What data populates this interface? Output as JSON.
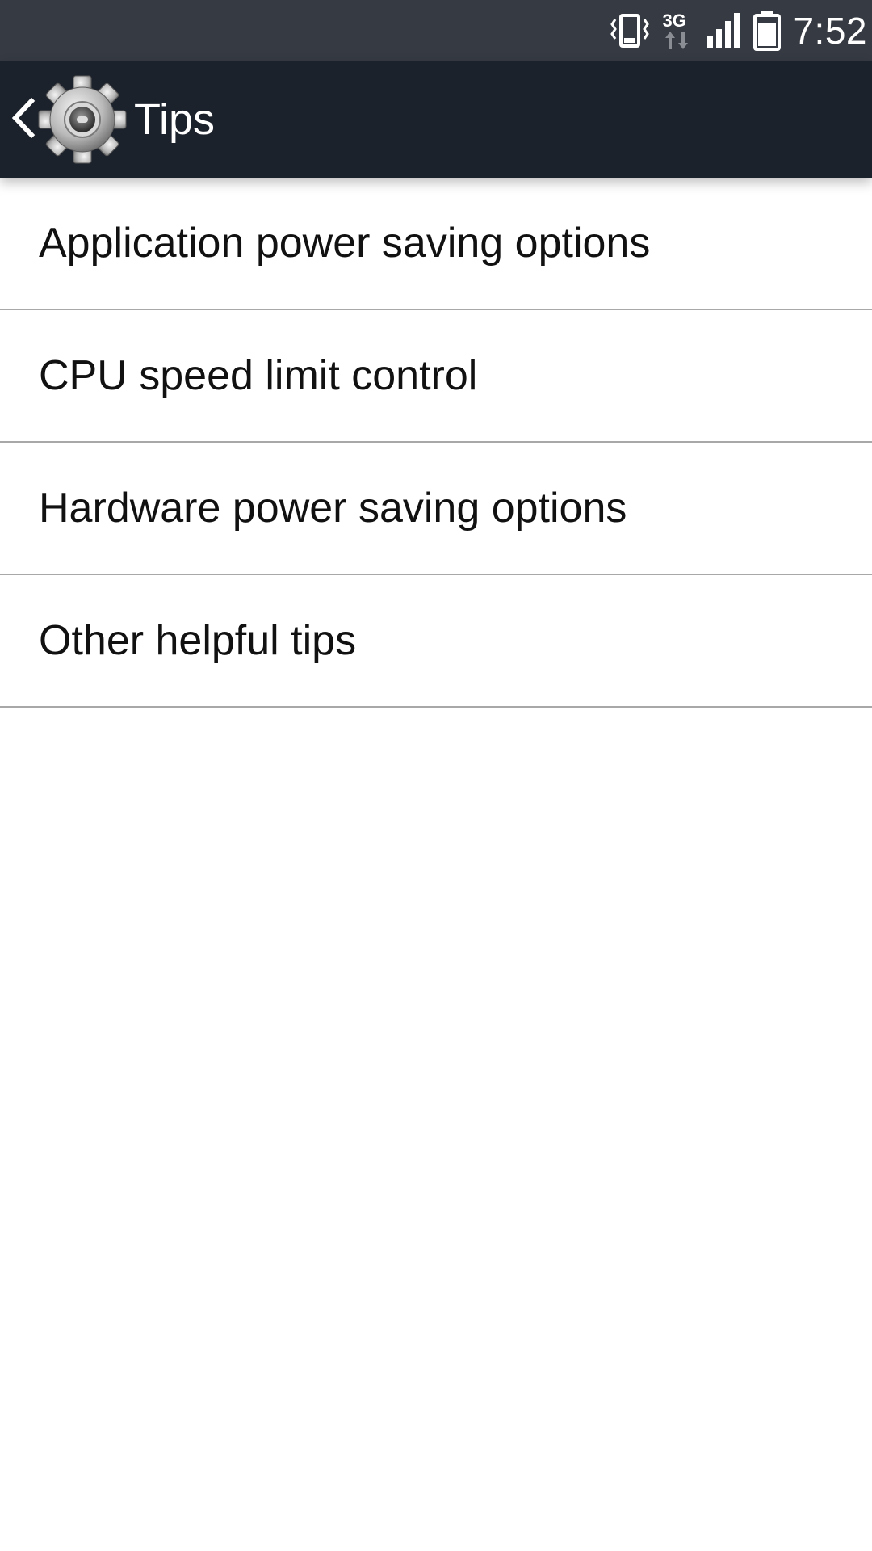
{
  "status_bar": {
    "time": "7:52",
    "network_label": "3G",
    "icons": [
      "vibrate-icon",
      "network-3g-icon",
      "signal-icon",
      "battery-icon"
    ]
  },
  "action_bar": {
    "title": "Tips",
    "back_icon": "chevron-left-icon",
    "app_icon": "gear-icon"
  },
  "menu": {
    "items": [
      {
        "label": "Application power saving options"
      },
      {
        "label": "CPU speed limit control"
      },
      {
        "label": "Hardware power saving options"
      },
      {
        "label": "Other helpful tips"
      }
    ]
  },
  "colors": {
    "status_bar_bg": "#363a42",
    "action_bar_bg": "#1c222c",
    "background": "#ffffff",
    "divider": "#a8a8a8",
    "text": "#111111"
  }
}
